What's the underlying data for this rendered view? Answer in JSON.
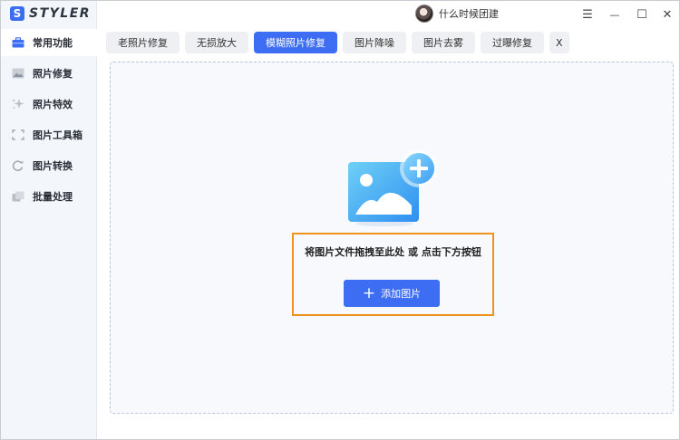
{
  "app": {
    "logo_letter": "S",
    "name": "STYLER"
  },
  "user": {
    "name": "什么时候团建"
  },
  "window_controls": {
    "menu": "☰",
    "minimize": "—",
    "maximize": "☐",
    "close": "✕"
  },
  "sidebar": {
    "items": [
      {
        "label": "常用功能",
        "icon": "toolbox-icon",
        "active": true
      },
      {
        "label": "照片修复",
        "icon": "photo-icon",
        "active": false
      },
      {
        "label": "照片特效",
        "icon": "sparkle-icon",
        "active": false
      },
      {
        "label": "图片工具箱",
        "icon": "crop-icon",
        "active": false
      },
      {
        "label": "图片转换",
        "icon": "convert-icon",
        "active": false
      },
      {
        "label": "批量处理",
        "icon": "batch-icon",
        "active": false
      }
    ]
  },
  "tabs": [
    {
      "label": "老照片修复",
      "active": false
    },
    {
      "label": "无损放大",
      "active": false
    },
    {
      "label": "模糊照片修复",
      "active": true
    },
    {
      "label": "图片降噪",
      "active": false
    },
    {
      "label": "图片去雾",
      "active": false
    },
    {
      "label": "过曝修复",
      "active": false
    }
  ],
  "tab_close": "X",
  "dropzone": {
    "instruction": "将图片文件拖拽至此处 或 点击下方按钮",
    "button_label": "添加图片",
    "button_icon": "+"
  },
  "colors": {
    "accent": "#3d6df2",
    "highlight": "#f0921e"
  }
}
